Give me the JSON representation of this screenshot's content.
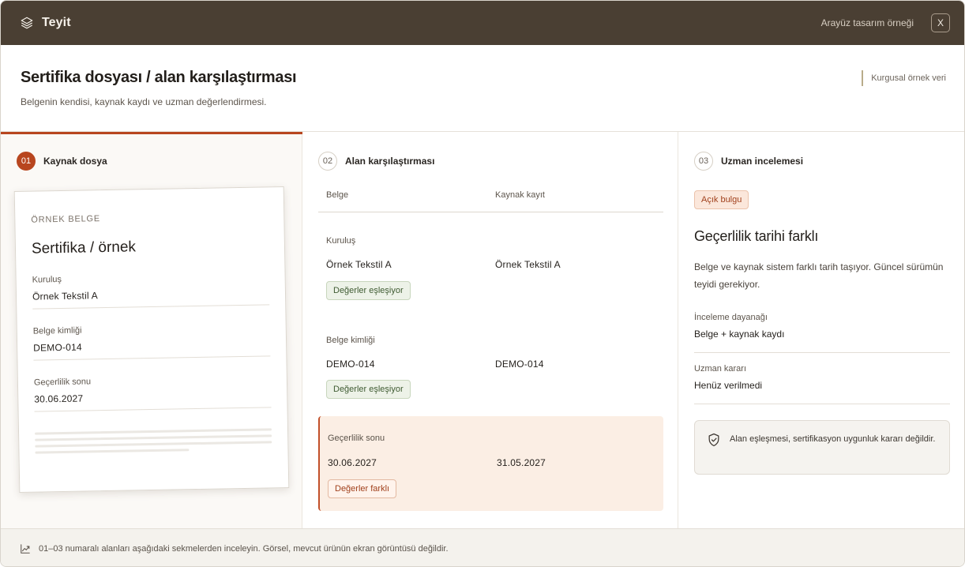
{
  "topbar": {
    "brand_icon": "layers-icon",
    "brand_name": "Teyit",
    "note": "Arayüz tasarım örneği",
    "close_label": "X"
  },
  "header": {
    "title": "Sertifika dosyası / alan karşılaştırması",
    "subtitle": "Belgenin kendisi, kaynak kaydı ve uzman değerlendirmesi.",
    "tag": "Kurgusal örnek veri"
  },
  "accent_color": "#b8461f",
  "steps": [
    {
      "num": "01",
      "title": "Kaynak dosya"
    },
    {
      "num": "02",
      "title": "Alan karşılaştırması"
    },
    {
      "num": "03",
      "title": "Uzman incelemesi"
    }
  ],
  "document": {
    "kicker": "ÖRNEK BELGE",
    "title": "Sertifika / örnek",
    "fields": [
      {
        "label": "Kuruluş",
        "value": "Örnek Tekstil A"
      },
      {
        "label": "Belge kimliği",
        "value": "DEMO-014"
      },
      {
        "label": "Geçerlilik sonu",
        "value": "30.06.2027"
      }
    ]
  },
  "comparison": {
    "col_document": "Belge",
    "col_source": "Kaynak kayıt",
    "rows": [
      {
        "label": "Kuruluş",
        "document": "Örnek Tekstil A",
        "source": "Örnek Tekstil A",
        "status": "Değerler eşleşiyor"
      },
      {
        "label": "Belge kimliği",
        "document": "DEMO-014",
        "source": "DEMO-014",
        "status": "Değerler eşleşiyor"
      },
      {
        "label": "Geçerlilik sonu",
        "document": "30.06.2027",
        "source": "31.05.2027",
        "status": "Değerler farklı"
      }
    ]
  },
  "review": {
    "badge": "Açık bulgu",
    "title": "Geçerlilik tarihi farklı",
    "description": "Belge ve kaynak sistem farklı tarih taşıyor. Güncel sürümün teyidi gerekiyor.",
    "fields": [
      {
        "label": "İnceleme dayanağı",
        "value": "Belge + kaynak kaydı"
      },
      {
        "label": "Uzman kararı",
        "value": "Henüz verilmedi"
      }
    ],
    "note_icon": "shield-check-icon",
    "note": "Alan eşleşmesi, sertifikasyon uygunluk kararı değildir."
  },
  "footer": {
    "icon": "trend-chart-icon",
    "text": "01–03 numaralı alanları aşağıdaki sekmelerden inceleyin. Görsel, mevcut ürünün ekran görüntüsü değildir."
  }
}
